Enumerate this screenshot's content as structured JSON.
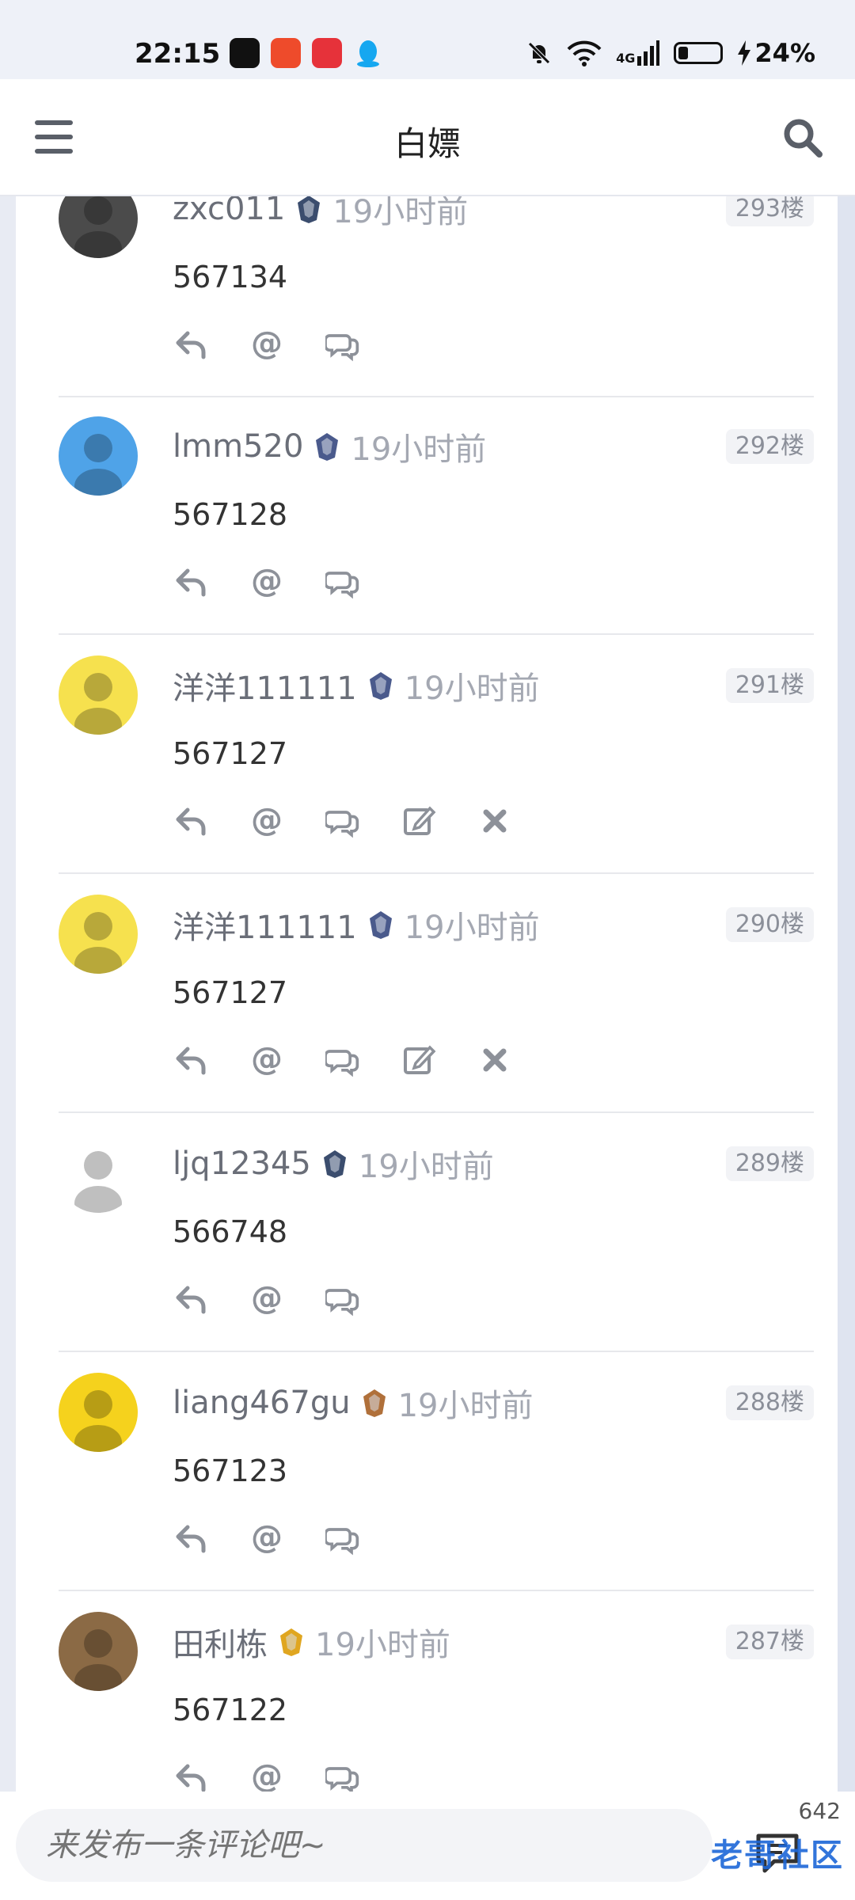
{
  "status_bar": {
    "time": "22:15",
    "network": "4G",
    "battery": "24%",
    "battery_level": 0.24,
    "app_icons": [
      "tiktok-icon",
      "video-icon",
      "music-icon",
      "qq-icon"
    ]
  },
  "header": {
    "title": "白嫖",
    "menu_icon": "hamburger-icon",
    "search_icon": "search-icon"
  },
  "posts": [
    {
      "user": "zxc011",
      "time": "19小时前",
      "floor": "293楼",
      "message": "567134",
      "badge_color": "#3b4d6e",
      "avatar_color": "#4b4b4b",
      "can_edit": false
    },
    {
      "user": "lmm520",
      "time": "19小时前",
      "floor": "292楼",
      "message": "567128",
      "badge_color": "#4a5a8c",
      "avatar_color": "#4fa3e8",
      "can_edit": false
    },
    {
      "user": "洋洋111111",
      "time": "19小时前",
      "floor": "291楼",
      "message": "567127",
      "badge_color": "#4a5a8c",
      "avatar_color": "#f6e14e",
      "can_edit": true
    },
    {
      "user": "洋洋111111",
      "time": "19小时前",
      "floor": "290楼",
      "message": "567127",
      "badge_color": "#4a5a8c",
      "avatar_color": "#f6e14e",
      "can_edit": true
    },
    {
      "user": "ljq12345",
      "time": "19小时前",
      "floor": "289楼",
      "message": "566748",
      "badge_color": "#3b4d6e",
      "avatar_color": "#ffffff",
      "can_edit": false
    },
    {
      "user": "liang467gu",
      "time": "19小时前",
      "floor": "288楼",
      "message": "567123",
      "badge_color": "#b0703a",
      "avatar_color": "#f5d21d",
      "can_edit": false
    },
    {
      "user": "田利栋",
      "time": "19小时前",
      "floor": "287楼",
      "message": "567122",
      "badge_color": "#e0a620",
      "avatar_color": "#8b6a45",
      "can_edit": false
    }
  ],
  "footer": {
    "comment_placeholder": "来发布一条评论吧~",
    "comment_count": "642",
    "watermark": "老哥社区"
  },
  "colors": {
    "page_bg": "#e8ebf3",
    "username": "#6a6e78",
    "time": "#a4a8b2",
    "floor_bg": "#f2f3f6",
    "icon": "#8d9199"
  }
}
